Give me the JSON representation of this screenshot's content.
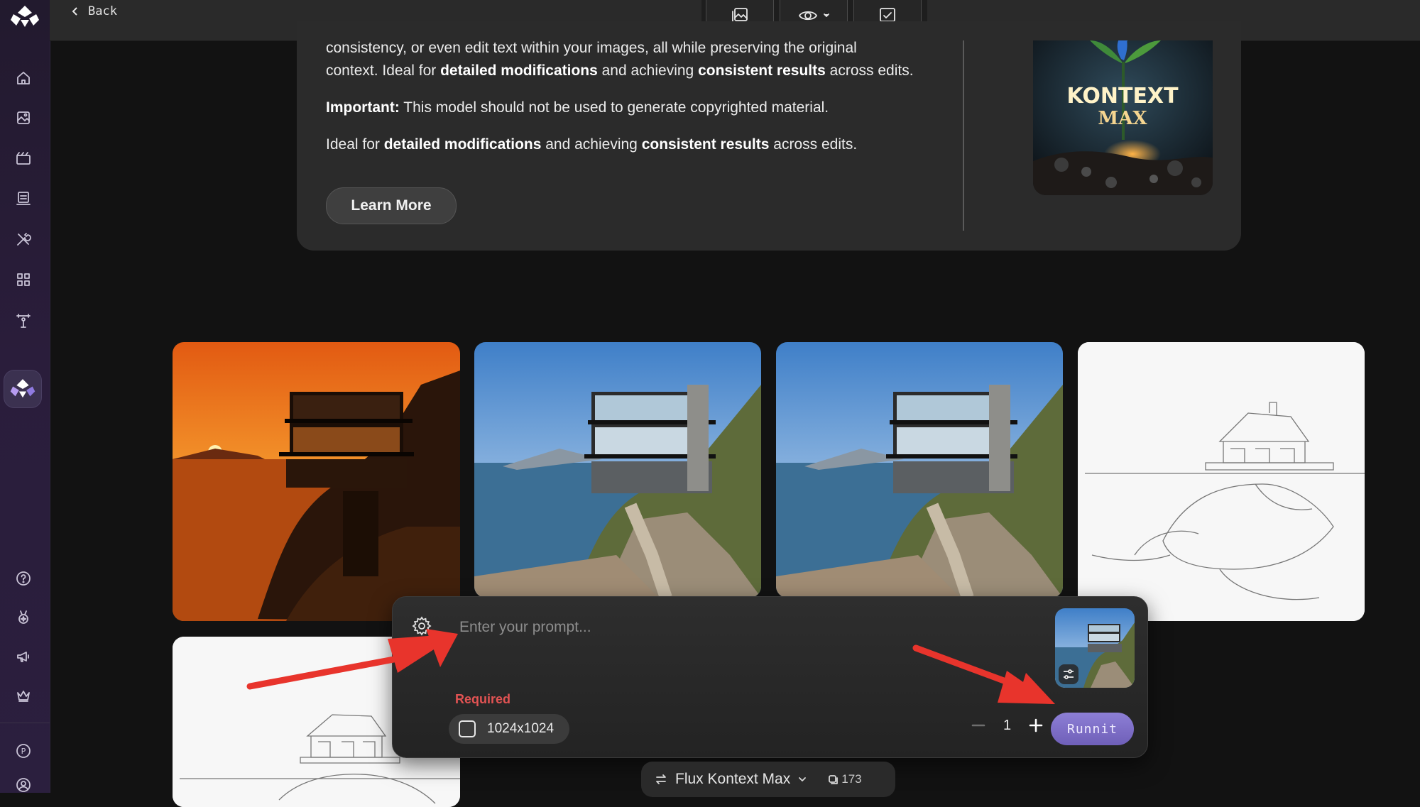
{
  "topbar": {
    "back_label": "Back",
    "buttons": [
      {
        "icon": "gallery-icon"
      },
      {
        "icon": "eye-icon",
        "has_dropdown": true
      },
      {
        "icon": "checklist-icon"
      }
    ]
  },
  "sidebar": {
    "items": [
      "home-icon",
      "images-icon",
      "video-icon",
      "library-icon",
      "tools-icon",
      "apps-icon",
      "training-icon"
    ],
    "bottom_items": [
      "help-icon",
      "rewards-icon",
      "announcements-icon",
      "crown-icon",
      "profile-badge-icon",
      "user-icon"
    ],
    "profile_badge": "P"
  },
  "info": {
    "line1": "consistency, or even edit text within your images, all while preserving the original",
    "line2_pre": "context. Ideal for ",
    "line2_b1": "detailed modifications",
    "line2_mid": " and achieving ",
    "line2_b2": "consistent results",
    "line2_post": " across edits.",
    "important_label": "Important:",
    "important_text": " This model should not be used to generate copyrighted material.",
    "line4_pre": "Ideal for ",
    "line4_b1": "detailed modifications",
    "line4_mid": " and achieving ",
    "line4_b2": "consistent results",
    "line4_post": " across edits.",
    "learn_more": "Learn More",
    "model_image_title": "KONTEXT",
    "model_image_subtitle": "MAX"
  },
  "prompt": {
    "placeholder": "Enter your prompt...",
    "required_label": "Required",
    "size": "1024x1024",
    "count": "1",
    "run_label": "Runnit"
  },
  "model": {
    "name": "Flux Kontext Max",
    "credits": "173"
  },
  "colors": {
    "accent": "#7b6bc8",
    "required": "#e25353",
    "annotation_arrow": "#e8342c"
  }
}
